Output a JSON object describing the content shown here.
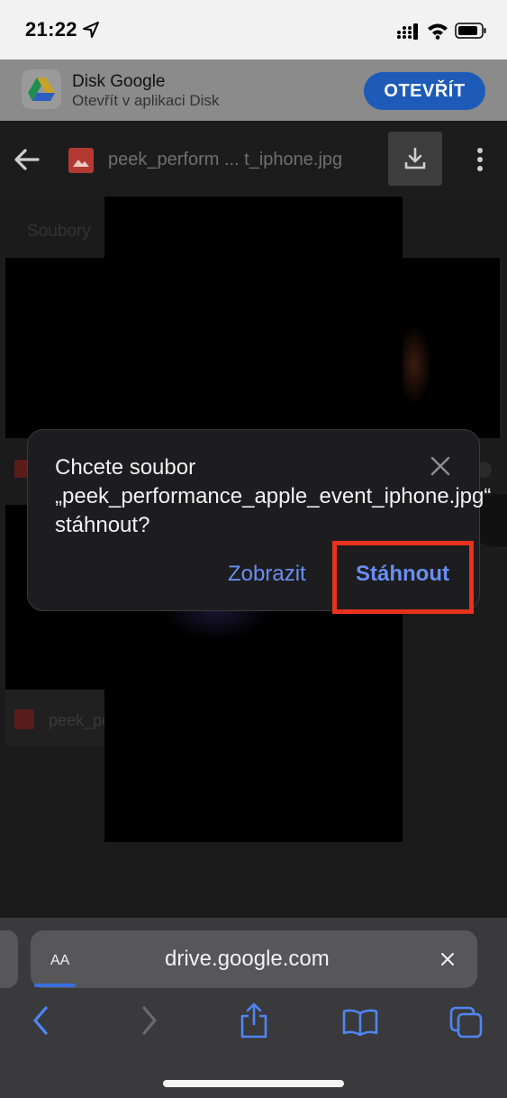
{
  "status_bar": {
    "time": "21:22"
  },
  "app_banner": {
    "title": "Disk Google",
    "subtitle": "Otevřít v aplikaci Disk",
    "open_label": "OTEVŘÍT"
  },
  "viewer": {
    "file_title": "peek_perform ... t_iphone.jpg"
  },
  "background_page": {
    "section_label": "Soubory",
    "row_label": "peek_pe"
  },
  "dialog": {
    "message": "Chcete soubor „peek_performance_apple_event_iphone.jpg“ stáhnout?",
    "view_label": "Zobrazit",
    "download_label": "Stáhnout"
  },
  "safari": {
    "aa_label": "AA",
    "url": "drive.google.com"
  },
  "colors": {
    "accent_blue": "#6a8ef2",
    "banner_button": "#1e5bb8",
    "highlight_red": "#e8321b"
  }
}
